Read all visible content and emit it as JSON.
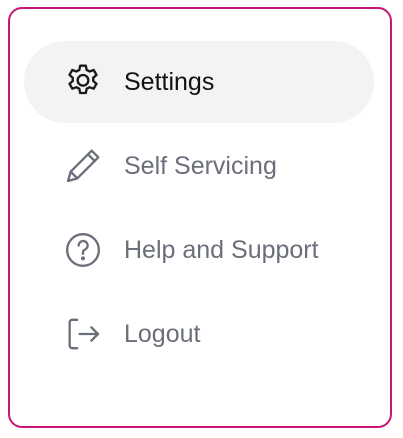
{
  "menu": {
    "items": [
      {
        "label": "Settings",
        "icon": "gear-icon",
        "active": true
      },
      {
        "label": "Self Servicing",
        "icon": "pencil-icon",
        "active": false
      },
      {
        "label": "Help and Support",
        "icon": "question-circle-icon",
        "active": false
      },
      {
        "label": "Logout",
        "icon": "logout-icon",
        "active": false
      }
    ]
  },
  "colors": {
    "border": "#c8157a",
    "active_background": "#f3f3f5",
    "active_text": "#111111",
    "inactive_text": "#6b6f7a"
  }
}
